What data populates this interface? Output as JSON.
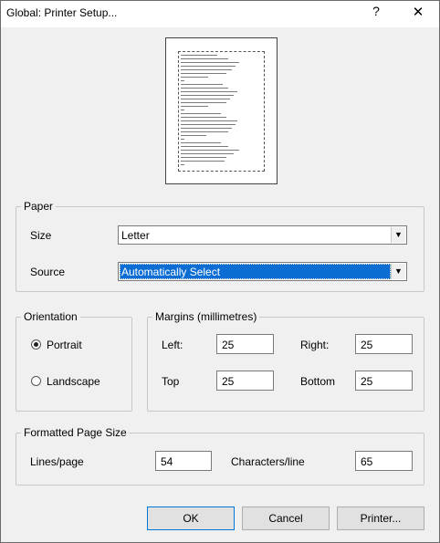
{
  "window": {
    "title": "Global: Printer Setup...",
    "help_glyph": "?",
    "close_glyph": "✕"
  },
  "paper": {
    "group_label": "Paper",
    "size_label": "Size",
    "size_value": "Letter",
    "source_label": "Source",
    "source_value": "Automatically Select"
  },
  "orientation": {
    "group_label": "Orientation",
    "portrait_label": "Portrait",
    "landscape_label": "Landscape",
    "selected": "Portrait"
  },
  "margins": {
    "group_label": "Margins (millimetres)",
    "left_label": "Left:",
    "left_value": "25",
    "right_label": "Right:",
    "right_value": "25",
    "top_label": "Top",
    "top_value": "25",
    "bottom_label": "Bottom",
    "bottom_value": "25"
  },
  "formatted": {
    "group_label": "Formatted Page Size",
    "lines_label": "Lines/page",
    "lines_value": "54",
    "chars_label": "Characters/line",
    "chars_value": "65"
  },
  "buttons": {
    "ok": "OK",
    "cancel": "Cancel",
    "printer": "Printer..."
  },
  "colors": {
    "selection": "#0a6dd4",
    "dialog_bg": "#f0f0f0",
    "default_button_border": "#0078d7"
  },
  "icons": {
    "dropdown": "chevron-down-icon",
    "close": "close-icon",
    "help": "help-icon"
  }
}
